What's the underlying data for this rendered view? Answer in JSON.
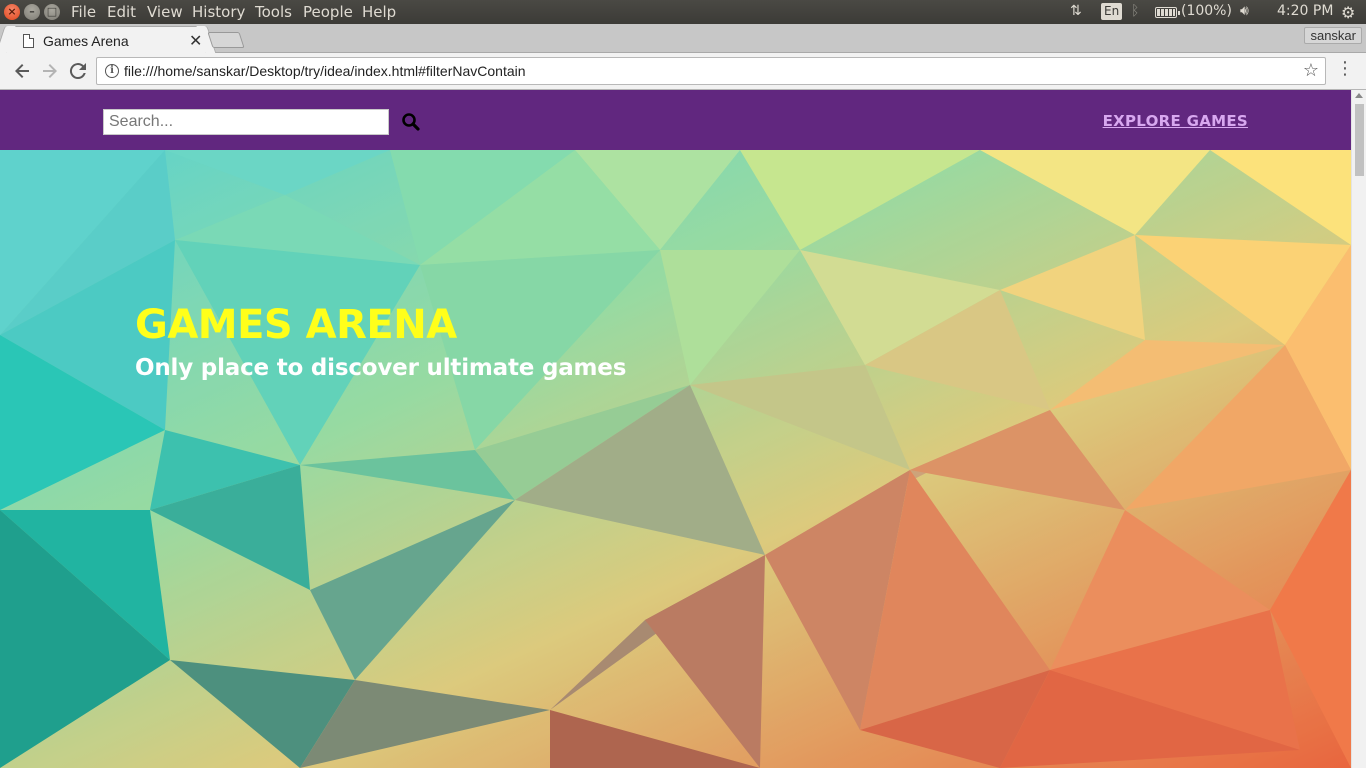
{
  "system_bar": {
    "menus": [
      "File",
      "Edit",
      "View",
      "History",
      "Tools",
      "People",
      "Help"
    ],
    "lang": "En",
    "battery": "(100%)",
    "time": "4:20 PM"
  },
  "browser": {
    "tab_title": "Games Arena",
    "profile": "sanskar",
    "url": "file:///home/sanskar/Desktop/try/idea/index.html#filterNavContain"
  },
  "page": {
    "search": {
      "placeholder": "Search..."
    },
    "nav_link": "EXPLORE GAMES",
    "hero_title": "GAMES ARENA",
    "hero_subtitle": "Only place to discover ultimate games"
  },
  "colors": {
    "nav_bg": "#61277f",
    "nav_link": "#d8a8f0",
    "hero_title": "#ffff1a",
    "hero_subtitle": "#ffffff"
  }
}
